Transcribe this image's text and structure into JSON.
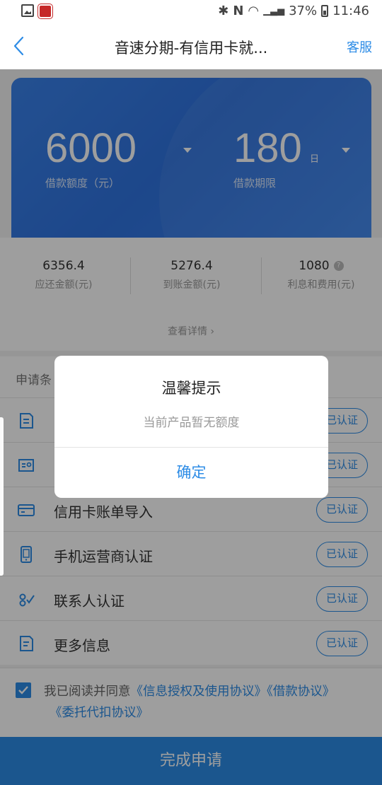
{
  "status_bar": {
    "battery": "37%",
    "time": "11:46"
  },
  "nav": {
    "title": "音速分期-有信用卡就...",
    "service_label": "客服"
  },
  "loan": {
    "amount": "6000",
    "amount_label": "借款额度（元）",
    "term": "180",
    "term_unit": "日",
    "term_label": "借款期限"
  },
  "summary": {
    "items": [
      {
        "value": "6356.4",
        "label": "应还金额(元)"
      },
      {
        "value": "5276.4",
        "label": "到账金额(元)"
      },
      {
        "value": "1080",
        "label": "利息和费用(元)"
      }
    ],
    "detail_link": "查看详情 ›"
  },
  "conditions": {
    "title": "申请条",
    "items": [
      {
        "label": "",
        "icon": "document-icon",
        "status": "已认证"
      },
      {
        "label": "",
        "icon": "id-card-icon",
        "status": "已认证"
      },
      {
        "label": "信用卡账单导入",
        "icon": "credit-card-icon",
        "status": "已认证"
      },
      {
        "label": "手机运营商认证",
        "icon": "phone-icon",
        "status": "已认证"
      },
      {
        "label": "联系人认证",
        "icon": "contacts-icon",
        "status": "已认证"
      },
      {
        "label": "更多信息",
        "icon": "document-icon",
        "status": "已认证"
      }
    ]
  },
  "agreement": {
    "prefix": "我已阅读并同意",
    "link1": "《信息授权及使用协议》",
    "link2": "《借款协议》",
    "link3": "《委托代扣协议》",
    "checked": true
  },
  "submit_label": "完成申请",
  "dialog": {
    "title": "温馨提示",
    "message": "当前产品暂无额度",
    "confirm_label": "确定"
  },
  "colors": {
    "accent": "#2d8ce6",
    "card": "#3a82ea"
  }
}
